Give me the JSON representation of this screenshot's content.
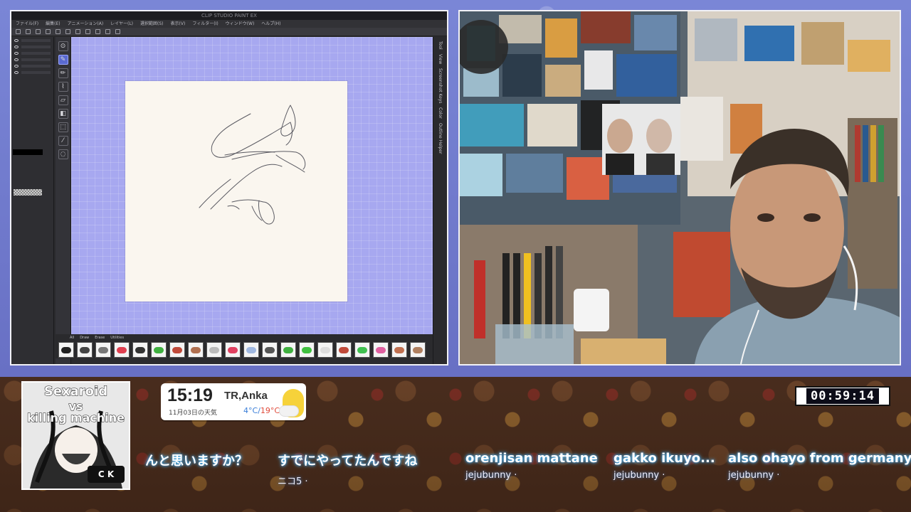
{
  "app": {
    "title": "CLIP STUDIO PAINT EX",
    "menus": [
      "ファイル(F)",
      "編集(E)",
      "アニメーション(A)",
      "レイヤー(L)",
      "選択範囲(S)",
      "表示(V)",
      "フィルター(I)",
      "ウィンドウ(W)",
      "ヘルプ(H)"
    ],
    "tools": [
      "zoom-icon",
      "pen-icon",
      "pencil-icon",
      "brush-icon",
      "eraser-icon",
      "fill-icon",
      "select-icon",
      "eyedropper-icon",
      "lasso-icon"
    ],
    "right_tabs": [
      "Tool",
      "View",
      "Screenshot Keys",
      "Color",
      "Outline Helper"
    ],
    "brush_tabs": [
      "All",
      "Draw",
      "Erase",
      "Utilities"
    ],
    "brush_colors": [
      "#222222",
      "#444444",
      "#777777",
      "#e04050",
      "#333333",
      "#40b040",
      "#c04a3a",
      "#b07050",
      "#bbbbbb",
      "#e04060",
      "#a0b8e0",
      "#555555",
      "#40b040",
      "#40c040",
      "#dddddd",
      "#c04a3a",
      "#40c050",
      "#e060a0",
      "#c07050",
      "#b08060"
    ]
  },
  "overlay": {
    "cover": {
      "line1": "Sexaroid",
      "line2": "vs",
      "line3": "killing machine",
      "badge": "C K"
    },
    "weather": {
      "time": "15:19",
      "location": "TR,Anka",
      "date": "11月03日の天気",
      "temp_low": "4°C",
      "sep": "/",
      "temp_high": "19°C"
    },
    "timer": "00:59:14",
    "chat": [
      {
        "message": "んと思いますか？",
        "user": ""
      },
      {
        "message": "すでにやってたんですね",
        "user": "ニコ5 ·"
      },
      {
        "message": "orenjisan mattane",
        "user": "jejubunny ·"
      },
      {
        "message": "gakko ikuyo...",
        "user": "jejubunny ·"
      },
      {
        "message": "also ohayo from germany",
        "user": "jejubunny ·"
      }
    ]
  }
}
